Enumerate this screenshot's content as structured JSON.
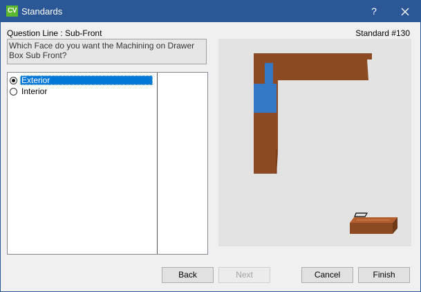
{
  "window": {
    "title": "Standards",
    "app_icon_text": "CV",
    "help_label": "?",
    "titlebar_color": "#2b5797"
  },
  "question": {
    "line_label": "Question Line : Sub-Front",
    "standard_label": "Standard #130",
    "text": "Which Face do you want the Machining on Drawer Box Sub Front?"
  },
  "options": [
    {
      "label": "Exterior",
      "selected": true
    },
    {
      "label": "Interior",
      "selected": false
    }
  ],
  "preview": {
    "wood_color": "#8b4a22",
    "highlight_color": "#3478c6",
    "background": "#e3e3e3"
  },
  "buttons": {
    "back": "Back",
    "next": "Next",
    "cancel": "Cancel",
    "finish": "Finish"
  }
}
